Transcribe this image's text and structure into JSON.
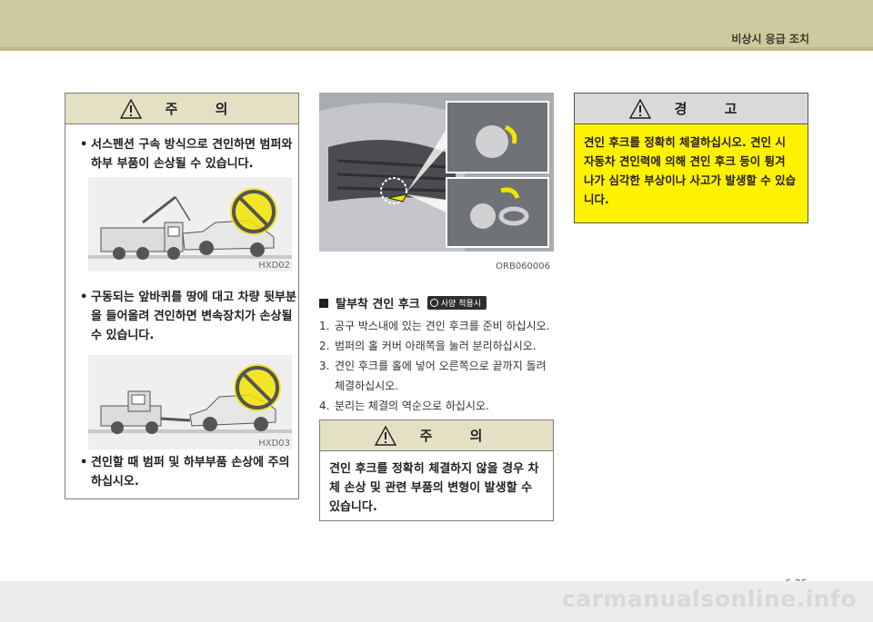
{
  "header": {
    "section_title": "비상시 응급 조치"
  },
  "left_caution": {
    "title": "주 의",
    "bullets": [
      "서스펜션 구속 방식으로 견인하면 범퍼와 하부 부품이 손상될 수 있습니다.",
      "구동되는 앞바퀴를 땅에 대고 차량 뒷부분을 들어올려 견인하면 변속장치가 손상될 수 있습니다.",
      "견인할 때 범퍼 및 하부부품 손상에 주의하십시오."
    ],
    "image_codes": [
      "HXD02",
      "HXD03"
    ]
  },
  "middle": {
    "photo_code": "ORB060006",
    "subheading": "탈부착 견인 후크",
    "badge": "사양 적용시",
    "steps": [
      {
        "num": "1.",
        "text": "공구 박스내에 있는 견인 후크를 준비 하십시오."
      },
      {
        "num": "2.",
        "text": "범퍼의 홀 커버 아래쪽을 눌러 분리하십시오."
      },
      {
        "num": "3.",
        "text": "견인 후크를 홀에 넣어 오른쪽으로 끝까지 돌려 체결하십시오."
      },
      {
        "num": "4.",
        "text": "분리는 체결의 역순으로 하십시오."
      }
    ],
    "caution": {
      "title": "주 의",
      "text": "견인 후크를 정확히 체결하지 않을 경우 차체 손상 및 관련 부품의 변형이 발생할 수 있습니다."
    }
  },
  "right_warning": {
    "title": "경 고",
    "text": "견인 후크를 정확히 체결하십시오. 견인 시 자동차 견인력에 의해 견인 후크 등이 튕겨 나가 심각한 부상이나 사고가 발생할 수 있습니다."
  },
  "page_number": "6-25",
  "watermark": "carmanualsonline.info",
  "colors": {
    "header": "#cfc9a0",
    "box_head": "#e4e0c4",
    "warning_fill": "#fff200",
    "warning_head": "#d9d9d9"
  }
}
